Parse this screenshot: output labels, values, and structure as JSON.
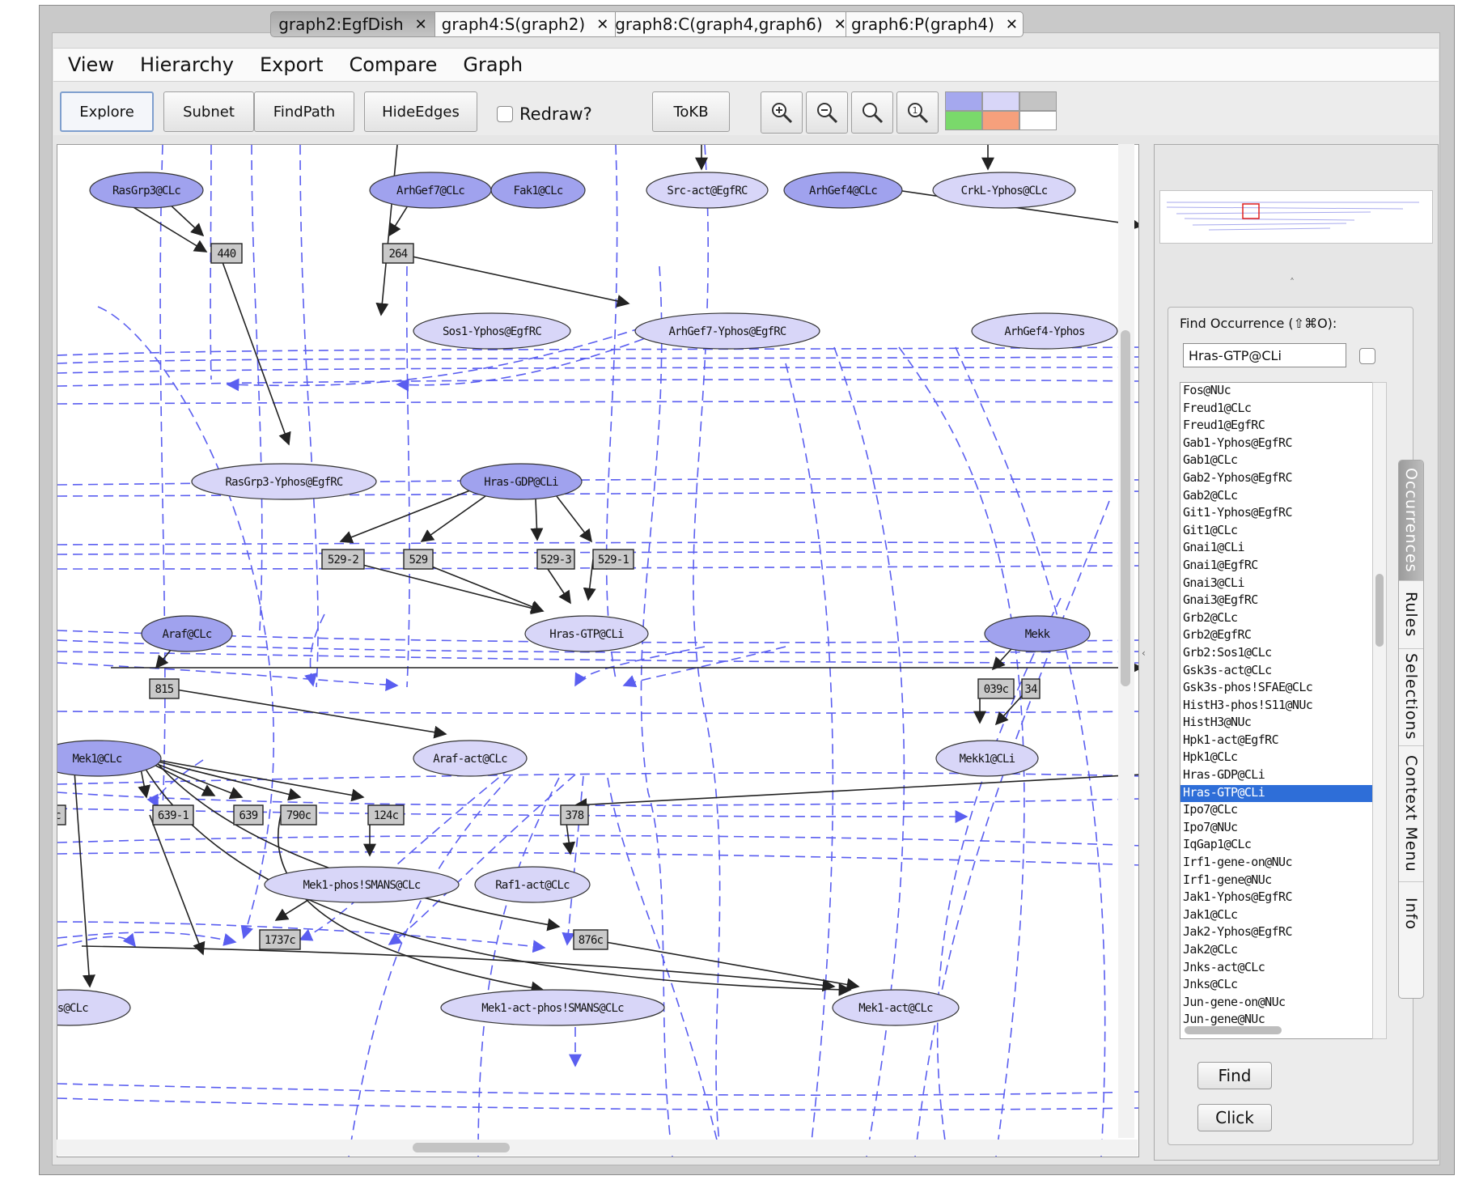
{
  "tabs": [
    {
      "label": "graph2:EgfDish",
      "active": true
    },
    {
      "label": "graph4:S(graph2)",
      "active": false
    },
    {
      "label": "graph8:C(graph4,graph6)",
      "active": false
    },
    {
      "label": "graph6:P(graph4)",
      "active": false
    }
  ],
  "menu": [
    "View",
    "Hierarchy",
    "Export",
    "Compare",
    "Graph"
  ],
  "toolbar": {
    "explore": "Explore",
    "subnet": "Subnet",
    "findpath": "FindPath",
    "hideedges": "HideEdges",
    "redraw": "Redraw?",
    "tokb": "ToKB"
  },
  "swatches": [
    "#a5a8ee",
    "#d8d6f8",
    "#c4c4c4",
    "#7ad96b",
    "#f6a07c",
    "#ffffff"
  ],
  "graph": {
    "colors": {
      "node_dark": "#a0a2ee",
      "node_light": "#d8d6f8",
      "box": "#c9c9c9",
      "dashed": "#5a5ef0",
      "solid": "#222222"
    },
    "nodes": [
      {
        "label": "RasGrp3@CLc",
        "shade": "dark"
      },
      {
        "label": "ArhGef7@CLc",
        "shade": "dark"
      },
      {
        "label": "Fak1@CLc",
        "shade": "dark"
      },
      {
        "label": "Src-act@EgfRC",
        "shade": "light"
      },
      {
        "label": "ArhGef4@CLc",
        "shade": "dark"
      },
      {
        "label": "CrkL-Yphos@CLc",
        "shade": "light"
      },
      {
        "label": "Sos1-Yphos@EgfRC",
        "shade": "light"
      },
      {
        "label": "ArhGef7-Yphos@EgfRC",
        "shade": "light"
      },
      {
        "label": "ArhGef4-Yphos",
        "shade": "light"
      },
      {
        "label": "RasGrp3-Yphos@EgfRC",
        "shade": "light"
      },
      {
        "label": "Hras-GDP@CLi",
        "shade": "dark"
      },
      {
        "label": "Araf@CLc",
        "shade": "dark"
      },
      {
        "label": "Hras-GTP@CLi",
        "shade": "light"
      },
      {
        "label": "Mekk",
        "shade": "dark"
      },
      {
        "label": "Araf-act@CLc",
        "shade": "light"
      },
      {
        "label": "Mekk1@CLi",
        "shade": "light"
      },
      {
        "label": "Mek1@CLc",
        "shade": "dark"
      },
      {
        "label": "Mek1-phos!SMANS@CLc",
        "shade": "light"
      },
      {
        "label": "Raf1-act@CLc",
        "shade": "light"
      },
      {
        "label": "Mek1-act-phos!SMANS@CLc",
        "shade": "light"
      },
      {
        "label": "Mek1-act@CLc",
        "shade": "light"
      },
      {
        "label": "ps@CLc",
        "shade": "light"
      }
    ],
    "boxes": [
      "440",
      "264",
      "529-2",
      "529",
      "529-3",
      "529-1",
      "815",
      "039c",
      "34",
      "c",
      "639-1",
      "639",
      "790c",
      "124c",
      "378",
      "1737c",
      "876c"
    ]
  },
  "find": {
    "label": "Find Occurrence (⇧⌘O):",
    "value": "Hras-GTP@CLi",
    "items": [
      "Fos@NUc",
      "Freud1@CLc",
      "Freud1@EgfRC",
      "Gab1-Yphos@EgfRC",
      "Gab1@CLc",
      "Gab2-Yphos@EgfRC",
      "Gab2@CLc",
      "Git1-Yphos@EgfRC",
      "Git1@CLc",
      "Gnai1@CLi",
      "Gnai1@EgfRC",
      "Gnai3@CLi",
      "Gnai3@EgfRC",
      "Grb2@CLc",
      "Grb2@EgfRC",
      "Grb2:Sos1@CLc",
      "Gsk3s-act@CLc",
      "Gsk3s-phos!SFAE@CLc",
      "HistH3-phos!S11@NUc",
      "HistH3@NUc",
      "Hpk1-act@EgfRC",
      "Hpk1@CLc",
      "Hras-GDP@CLi",
      "Hras-GTP@CLi",
      "Ipo7@CLc",
      "Ipo7@NUc",
      "IqGap1@CLc",
      "Irf1-gene-on@NUc",
      "Irf1-gene@NUc",
      "Jak1-Yphos@EgfRC",
      "Jak1@CLc",
      "Jak2-Yphos@EgfRC",
      "Jak2@CLc",
      "Jnks-act@CLc",
      "Jnks@CLc",
      "Jun-gene-on@NUc",
      "Jun-gene@NUc"
    ],
    "selected": "Hras-GTP@CLi",
    "find_button": "Find",
    "click_button": "Click"
  },
  "side_tabs": [
    {
      "label": "Occurrences",
      "active": true
    },
    {
      "label": "Rules",
      "active": false
    },
    {
      "label": "Selections",
      "active": false
    },
    {
      "label": "Context Menu",
      "active": false
    },
    {
      "label": "Info",
      "active": false
    }
  ]
}
